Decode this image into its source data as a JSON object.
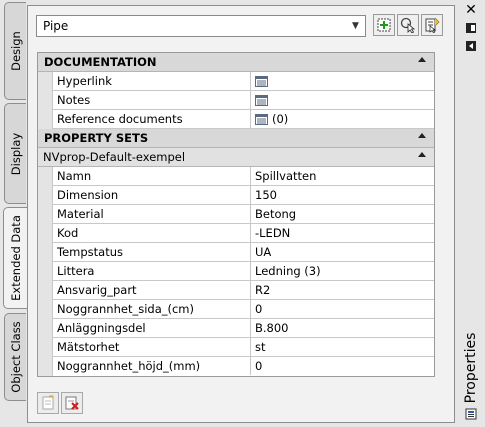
{
  "tabs": [
    {
      "label": "Design",
      "active": false
    },
    {
      "label": "Display",
      "active": false
    },
    {
      "label": "Extended Data",
      "active": true
    },
    {
      "label": "Object Class",
      "active": false
    }
  ],
  "selector": {
    "value": "Pipe"
  },
  "toolbar": {
    "icons": [
      "add-property-set-icon",
      "select-objects-icon",
      "quick-select-icon"
    ]
  },
  "documentation": {
    "title": "DOCUMENTATION",
    "rows": [
      {
        "name": "Hyperlink",
        "value": ""
      },
      {
        "name": "Notes",
        "value": ""
      },
      {
        "name": "Reference documents",
        "value": "(0)"
      }
    ]
  },
  "property_sets": {
    "title": "PROPERTY SETS",
    "set_name": "NVprop-Default-exempel",
    "rows": [
      {
        "name": "Namn",
        "value": "Spillvatten"
      },
      {
        "name": "Dimension",
        "value": "150"
      },
      {
        "name": "Material",
        "value": "Betong"
      },
      {
        "name": "Kod",
        "value": "-LEDN"
      },
      {
        "name": "Tempstatus",
        "value": "UA"
      },
      {
        "name": "Littera",
        "value": "Ledning (3)"
      },
      {
        "name": "Ansvarig_part",
        "value": "R2"
      },
      {
        "name": "Noggrannhet_sida_(cm)",
        "value": "0"
      },
      {
        "name": "Anläggningsdel",
        "value": "B.800"
      },
      {
        "name": "Mätstorhet",
        "value": "st"
      },
      {
        "name": "Noggrannhet_höjd_(mm)",
        "value": "0"
      }
    ]
  },
  "titlebar": {
    "label": "Properties"
  },
  "colors": {
    "panel": "#f2f2f2",
    "section": "#d8d8d8",
    "border": "#8d8d8d"
  }
}
